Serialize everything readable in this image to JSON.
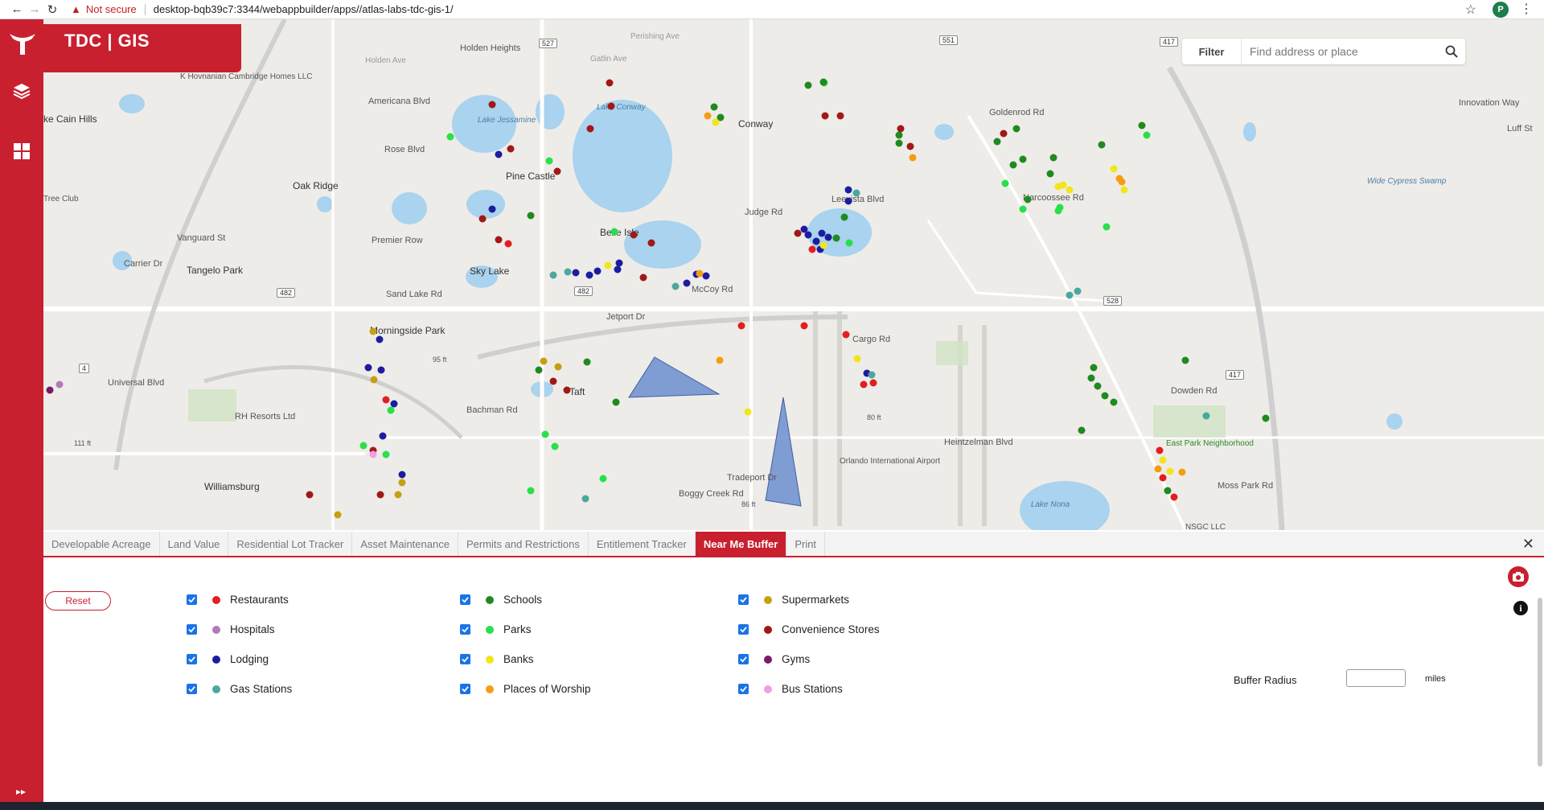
{
  "browser": {
    "security_label": "Not secure",
    "url": "desktop-bqb39c7:3344/webappbuilder/apps//atlas-labs-tdc-gis-1/",
    "profile_initial": "P"
  },
  "app": {
    "title": "TDC | GIS",
    "brand_color": "#c8202f"
  },
  "search": {
    "filter_label": "Filter",
    "placeholder": "Find address or place"
  },
  "map_labels": [
    {
      "text": "Holden Heights"
    },
    {
      "text": "K Hovnanian Cambridge Homes LLC"
    },
    {
      "text": "Americana Blvd"
    },
    {
      "text": "ke Cain Hills"
    },
    {
      "text": "Rose Blvd"
    },
    {
      "text": "Oak Ridge"
    },
    {
      "text": "Pine Castle"
    },
    {
      "text": "Lake Jessamine"
    },
    {
      "text": "Lake Conway"
    },
    {
      "text": "Conway"
    },
    {
      "text": "Belle Isle"
    },
    {
      "text": "Judge Rd"
    },
    {
      "text": "Vanguard St"
    },
    {
      "text": "Premier Row"
    },
    {
      "text": "Carrier Dr"
    },
    {
      "text": "Tangelo Park"
    },
    {
      "text": "Sky Lake"
    },
    {
      "text": "Sand Lake Rd"
    },
    {
      "text": "McCoy Rd"
    },
    {
      "text": "Jetport Dr"
    },
    {
      "text": "Morningside Park"
    },
    {
      "text": "Universal Blvd"
    },
    {
      "text": "RH Resorts Ltd"
    },
    {
      "text": "Williamsburg"
    },
    {
      "text": "Bachman Rd"
    },
    {
      "text": "Taft"
    },
    {
      "text": "Cargo Rd"
    },
    {
      "text": "Orlando International Airport"
    },
    {
      "text": "Lake Nona"
    },
    {
      "text": "Wide Cypress Swamp"
    },
    {
      "text": "Dowden Rd"
    },
    {
      "text": "East Park Neighborhood"
    },
    {
      "text": "Moss Park Rd"
    },
    {
      "text": "NSGC LLC"
    },
    {
      "text": "Luff St"
    },
    {
      "text": "Innovation Way"
    },
    {
      "text": "Boggy Creek Rd"
    },
    {
      "text": "Tradeport Dr"
    },
    {
      "text": "Heintzelman Blvd"
    },
    {
      "text": "Goldenrod Rd"
    },
    {
      "text": "Narcoossee Rd"
    },
    {
      "text": "Leevista Blvd"
    },
    {
      "text": "95 ft"
    },
    {
      "text": "80 ft"
    },
    {
      "text": "86 ft"
    },
    {
      "text": "111 ft"
    },
    {
      "text": "Tree Club"
    },
    {
      "text": "Perishing Ave"
    },
    {
      "text": "Gatlin Ave"
    },
    {
      "text": "Holden Ave"
    }
  ],
  "road_shields": [
    "482",
    "482",
    "527",
    "551",
    "417",
    "528",
    "417",
    "4"
  ],
  "tabs": [
    {
      "label": "Developable Acreage",
      "active": false
    },
    {
      "label": "Land Value",
      "active": false
    },
    {
      "label": "Residential Lot Tracker",
      "active": false
    },
    {
      "label": "Asset Maintenance",
      "active": false
    },
    {
      "label": "Permits and Restrictions",
      "active": false
    },
    {
      "label": "Entitlement Tracker",
      "active": false
    },
    {
      "label": "Near Me Buffer",
      "active": true
    },
    {
      "label": "Print",
      "active": false
    }
  ],
  "panel": {
    "reset_label": "Reset",
    "buffer_radius_label": "Buffer Radius",
    "buffer_radius_value": "",
    "units_label": "miles",
    "layers": [
      {
        "label": "Restaurants",
        "color": "#e21f1f",
        "checked": true
      },
      {
        "label": "Schools",
        "color": "#1f8a1f",
        "checked": true
      },
      {
        "label": "Supermarkets",
        "color": "#c4a012",
        "checked": true
      },
      {
        "label": "Hospitals",
        "color": "#b07bb8",
        "checked": true
      },
      {
        "label": "Parks",
        "color": "#27e04a",
        "checked": true
      },
      {
        "label": "Convenience Stores",
        "color": "#a01818",
        "checked": true
      },
      {
        "label": "Lodging",
        "color": "#1c1ca0",
        "checked": true
      },
      {
        "label": "Banks",
        "color": "#f0e61a",
        "checked": true
      },
      {
        "label": "Gyms",
        "color": "#7a1a6a",
        "checked": true
      },
      {
        "label": "Gas Stations",
        "color": "#4aa8a0",
        "checked": true
      },
      {
        "label": "Places of Worship",
        "color": "#f59d12",
        "checked": true
      },
      {
        "label": "Bus Stations",
        "color": "#f29ee6",
        "checked": true
      }
    ]
  }
}
